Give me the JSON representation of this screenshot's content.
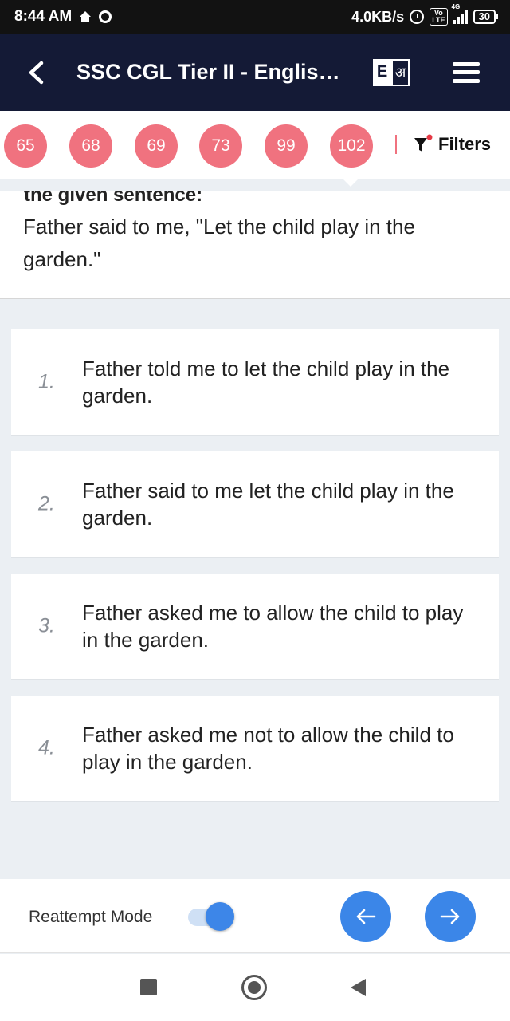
{
  "status_bar": {
    "time": "8:44 AM",
    "speed": "4.0KB/s",
    "network": "4G",
    "volte": "Vo LTE",
    "battery": "30"
  },
  "header": {
    "title": "SSC CGL Tier II - English...",
    "lang_en": "E",
    "lang_hi": "अ",
    "bg_color": "#141a36"
  },
  "question_numbers": [
    "65",
    "68",
    "69",
    "73",
    "99",
    "102"
  ],
  "filters_label": "Filters",
  "question": {
    "cut_line": "the given sentence:",
    "text": "Father said to me, \"Let the child play in the garden.\""
  },
  "options": [
    {
      "num": "1.",
      "text": "Father told me to let the child play in the garden."
    },
    {
      "num": "2.",
      "text": "Father said to me let the child play in the garden."
    },
    {
      "num": "3.",
      "text": "Father asked me to allow the child to play in the garden."
    },
    {
      "num": "4.",
      "text": "Father asked me not to allow the child to play in the garden."
    }
  ],
  "bottom": {
    "reattempt_label": "Reattempt Mode",
    "reattempt_on": true,
    "accent": "#3b86e8"
  },
  "colors": {
    "question_bubble": "#f0727f",
    "page_bg": "#ebeff3"
  }
}
